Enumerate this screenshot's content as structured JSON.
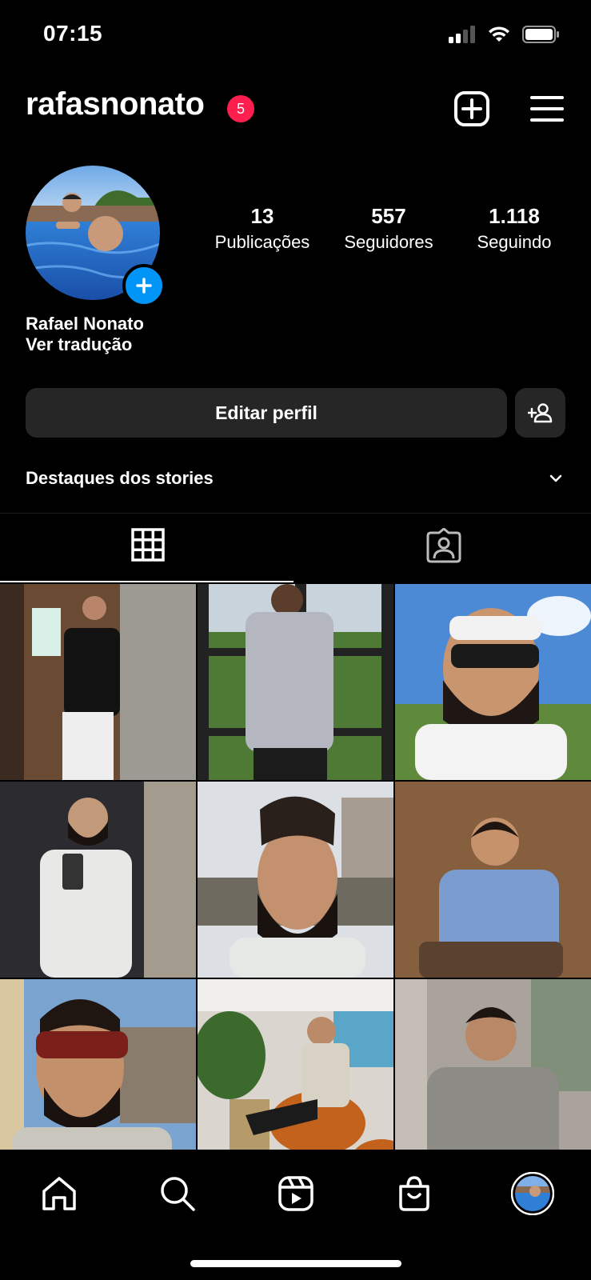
{
  "status_bar": {
    "time": "07:15"
  },
  "header": {
    "username": "rafasnonato",
    "notification_count": "5"
  },
  "profile": {
    "stats": [
      {
        "value": "13",
        "label": "Publicações"
      },
      {
        "value": "557",
        "label": "Seguidores"
      },
      {
        "value": "1.118",
        "label": "Seguindo"
      }
    ],
    "full_name": "Rafael Nonato",
    "translate_link": "Ver tradução"
  },
  "actions": {
    "edit_profile": "Editar perfil"
  },
  "highlights": {
    "label": "Destaques dos stories"
  },
  "icons": {
    "add_post": "plus-square-icon",
    "menu": "hamburger-menu-icon",
    "grid_tab": "grid-icon",
    "tagged_tab": "tagged-person-icon",
    "discover": "person-add-icon",
    "nav": [
      "home-icon",
      "search-icon",
      "reels-icon",
      "shop-icon",
      "profile-avatar"
    ]
  },
  "colors": {
    "badge": "#ff1f4e",
    "accent": "#0095f6",
    "button_bg": "#262626"
  }
}
